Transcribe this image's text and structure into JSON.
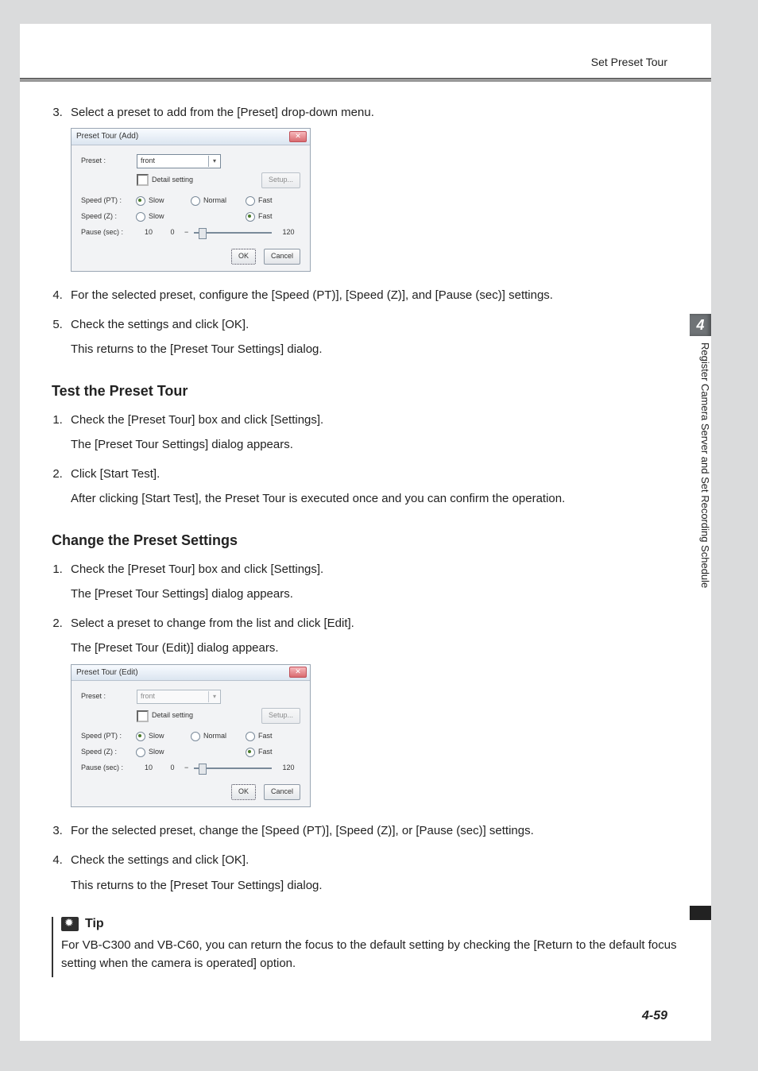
{
  "header": {
    "breadcrumb": "Set Preset Tour"
  },
  "sideTab": {
    "number": "4",
    "label": "Register Camera Server and Set Recording Schedule"
  },
  "pageNumber": "4-59",
  "intro": {
    "step3": "Select a preset to add from the [Preset] drop-down menu.",
    "step4": "For the selected preset, configure the [Speed (PT)], [Speed (Z)], and [Pause (sec)] settings.",
    "step5": "Check the settings and click [OK].",
    "step5_sub": "This returns to the [Preset Tour Settings] dialog."
  },
  "dialogAdd": {
    "title": "Preset Tour (Add)",
    "preset_label": "Preset :",
    "preset_value": "front",
    "detail_label": "Detail setting",
    "setup_btn": "Setup...",
    "speed_pt_label": "Speed (PT) :",
    "speed_z_label": "Speed (Z) :",
    "pause_label": "Pause (sec) :",
    "opt_slow": "Slow",
    "opt_normal": "Normal",
    "opt_fast": "Fast",
    "pause_min": "10",
    "pause_val": "0",
    "pause_max": "120",
    "ok": "OK",
    "cancel": "Cancel"
  },
  "test": {
    "heading": "Test the Preset Tour",
    "s1": "Check the [Preset Tour] box and click [Settings].",
    "s1_sub": "The [Preset Tour Settings] dialog appears.",
    "s2": "Click [Start Test].",
    "s2_sub": "After clicking [Start Test], the Preset Tour is executed once and you can confirm the operation."
  },
  "change": {
    "heading": "Change the Preset Settings",
    "s1": "Check the [Preset Tour] box and click [Settings].",
    "s1_sub": "The [Preset Tour Settings] dialog appears.",
    "s2": "Select a preset to change from the list and click [Edit].",
    "s2_sub": "The [Preset Tour (Edit)] dialog appears.",
    "s3": "For the selected preset, change the [Speed (PT)], [Speed (Z)], or [Pause (sec)] settings.",
    "s4": "Check the settings and click [OK].",
    "s4_sub": "This returns to the [Preset Tour Settings] dialog."
  },
  "dialogEdit": {
    "title": "Preset Tour (Edit)",
    "preset_label": "Preset :",
    "preset_value": "front",
    "detail_label": "Detail setting",
    "setup_btn": "Setup...",
    "speed_pt_label": "Speed (PT) :",
    "speed_z_label": "Speed (Z) :",
    "pause_label": "Pause (sec) :",
    "opt_slow": "Slow",
    "opt_normal": "Normal",
    "opt_fast": "Fast",
    "pause_min": "10",
    "pause_val": "0",
    "pause_max": "120",
    "ok": "OK",
    "cancel": "Cancel"
  },
  "tip": {
    "title": "Tip",
    "body": "For VB-C300 and VB-C60, you can return the focus to the default setting by checking the [Return to the default focus setting when the camera is operated] option."
  }
}
